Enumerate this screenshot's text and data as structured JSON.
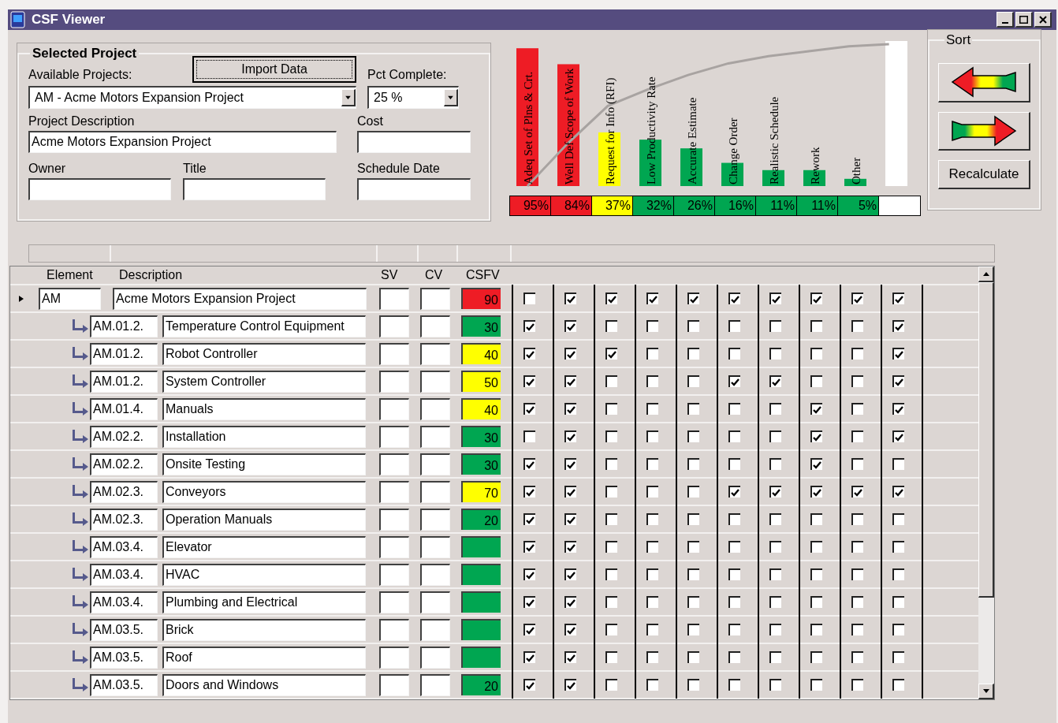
{
  "window": {
    "title": "CSF Viewer"
  },
  "project": {
    "group_title": "Selected Project",
    "import_button": "Import Data",
    "available_label": "Available Projects:",
    "available_value": "AM - Acme Motors Expansion Project",
    "pct_label": "Pct Complete:",
    "pct_value": "25 %",
    "description_label": "Project Description",
    "description_value": "Acme Motors Expansion Project",
    "cost_label": "Cost",
    "owner_label": "Owner",
    "title_label": "Title",
    "schedule_label": "Schedule Date"
  },
  "criteria": [
    {
      "name": "Adeq Set of Plns & Crt.",
      "percent": "95%",
      "color": "#ee1c25",
      "level": 0.95
    },
    {
      "name": "Well Def Scope of Work",
      "percent": "84%",
      "color": "#ee1c25",
      "level": 0.84
    },
    {
      "name": "Request for Info (RFI)",
      "percent": "37%",
      "color": "#ffff00",
      "level": 0.37
    },
    {
      "name": "Low Productivity Rate",
      "percent": "32%",
      "color": "#00a651",
      "level": 0.32
    },
    {
      "name": "Accurate Estimate",
      "percent": "26%",
      "color": "#00a651",
      "level": 0.26
    },
    {
      "name": "Change Order",
      "percent": "16%",
      "color": "#00a651",
      "level": 0.16
    },
    {
      "name": "Realistic Schedule",
      "percent": "11%",
      "color": "#00a651",
      "level": 0.11
    },
    {
      "name": "Rework",
      "percent": "11%",
      "color": "#00a651",
      "level": 0.11
    },
    {
      "name": "Other",
      "percent": "5%",
      "color": "#00a651",
      "level": 0.05
    }
  ],
  "sort": {
    "title": "Sort",
    "recalculate_button": "Recalculate"
  },
  "grid": {
    "columns": [
      "Element",
      "Description",
      "SV",
      "CV",
      "CSFV"
    ],
    "rows": [
      {
        "element": "AM",
        "description": "Acme Motors Expansion Project",
        "csfv": "90",
        "color": "#ee1c25",
        "selected": true,
        "checks": [
          false,
          true,
          true,
          true,
          true,
          true,
          true,
          true,
          true,
          true
        ],
        "children": [
          {
            "element": "AM.01.2.",
            "description": "Temperature Control Equipment",
            "csfv": "30",
            "color": "#00a651",
            "selected": false,
            "checks": [
              true,
              true,
              false,
              false,
              false,
              false,
              false,
              false,
              false,
              true
            ]
          },
          {
            "element": "AM.01.2.",
            "description": "Robot Controller",
            "csfv": "40",
            "color": "#ffff00",
            "selected": false,
            "checks": [
              true,
              true,
              true,
              false,
              false,
              false,
              false,
              false,
              false,
              true
            ]
          },
          {
            "element": "AM.01.2.",
            "description": "System Controller",
            "csfv": "50",
            "color": "#ffff00",
            "selected": false,
            "checks": [
              true,
              true,
              false,
              false,
              false,
              true,
              true,
              false,
              false,
              true
            ]
          },
          {
            "element": "AM.01.4.",
            "description": "Manuals",
            "csfv": "40",
            "color": "#ffff00",
            "selected": false,
            "checks": [
              true,
              true,
              false,
              false,
              false,
              false,
              false,
              true,
              false,
              true
            ]
          },
          {
            "element": "AM.02.2.",
            "description": "Installation",
            "csfv": "30",
            "color": "#00a651",
            "selected": false,
            "checks": [
              false,
              true,
              false,
              false,
              false,
              false,
              false,
              true,
              false,
              true
            ]
          },
          {
            "element": "AM.02.2.",
            "description": "Onsite Testing",
            "csfv": "30",
            "color": "#00a651",
            "selected": false,
            "checks": [
              true,
              true,
              false,
              false,
              false,
              false,
              false,
              true,
              false,
              false
            ]
          },
          {
            "element": "AM.02.3.",
            "description": "Conveyors",
            "csfv": "70",
            "color": "#ffff00",
            "selected": false,
            "checks": [
              true,
              true,
              false,
              false,
              false,
              true,
              true,
              true,
              true,
              true
            ]
          },
          {
            "element": "AM.02.3.",
            "description": "Operation Manuals",
            "csfv": "20",
            "color": "#00a651",
            "selected": false,
            "checks": [
              true,
              true,
              false,
              false,
              false,
              false,
              false,
              false,
              false,
              false
            ]
          },
          {
            "element": "AM.03.4.",
            "description": "Elevator",
            "color": "#00a651",
            "selected": false,
            "checks": [
              true,
              true,
              false,
              false,
              false,
              false,
              false,
              false,
              false,
              false
            ]
          },
          {
            "element": "AM.03.4.",
            "description": "HVAC",
            "color": "#00a651",
            "selected": false,
            "checks": [
              true,
              true,
              false,
              false,
              false,
              false,
              false,
              false,
              false,
              false
            ]
          },
          {
            "element": "AM.03.4.",
            "description": "Plumbing and Electrical",
            "color": "#00a651",
            "selected": false,
            "checks": [
              true,
              true,
              false,
              false,
              false,
              false,
              false,
              false,
              false,
              false
            ]
          },
          {
            "element": "AM.03.5.",
            "description": "Brick",
            "color": "#00a651",
            "selected": false,
            "checks": [
              true,
              true,
              false,
              false,
              false,
              false,
              false,
              false,
              false,
              false
            ]
          },
          {
            "element": "AM.03.5.",
            "description": "Roof",
            "color": "#00a651",
            "selected": false,
            "checks": [
              true,
              true,
              false,
              false,
              false,
              false,
              false,
              false,
              false,
              false
            ]
          },
          {
            "element": "AM.03.5.",
            "description": "Doors and Windows",
            "csfv": "20",
            "color": "#00a651",
            "selected": false,
            "checks": [
              true,
              true,
              false,
              false,
              false,
              false,
              false,
              false,
              false,
              false
            ]
          }
        ]
      }
    ]
  }
}
